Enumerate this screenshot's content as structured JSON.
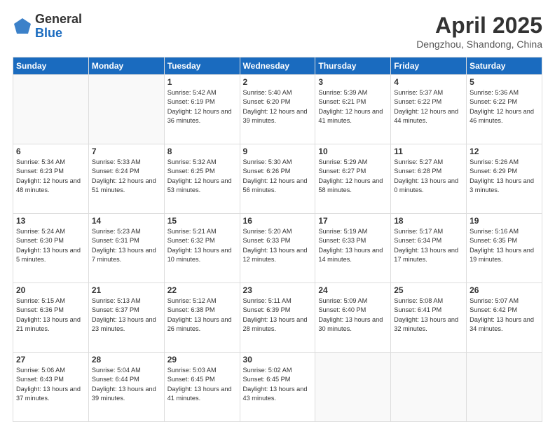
{
  "header": {
    "logo_general": "General",
    "logo_blue": "Blue",
    "month_title": "April 2025",
    "location": "Dengzhou, Shandong, China"
  },
  "weekdays": [
    "Sunday",
    "Monday",
    "Tuesday",
    "Wednesday",
    "Thursday",
    "Friday",
    "Saturday"
  ],
  "weeks": [
    [
      {
        "day": "",
        "info": ""
      },
      {
        "day": "",
        "info": ""
      },
      {
        "day": "1",
        "info": "Sunrise: 5:42 AM\nSunset: 6:19 PM\nDaylight: 12 hours and 36 minutes."
      },
      {
        "day": "2",
        "info": "Sunrise: 5:40 AM\nSunset: 6:20 PM\nDaylight: 12 hours and 39 minutes."
      },
      {
        "day": "3",
        "info": "Sunrise: 5:39 AM\nSunset: 6:21 PM\nDaylight: 12 hours and 41 minutes."
      },
      {
        "day": "4",
        "info": "Sunrise: 5:37 AM\nSunset: 6:22 PM\nDaylight: 12 hours and 44 minutes."
      },
      {
        "day": "5",
        "info": "Sunrise: 5:36 AM\nSunset: 6:22 PM\nDaylight: 12 hours and 46 minutes."
      }
    ],
    [
      {
        "day": "6",
        "info": "Sunrise: 5:34 AM\nSunset: 6:23 PM\nDaylight: 12 hours and 48 minutes."
      },
      {
        "day": "7",
        "info": "Sunrise: 5:33 AM\nSunset: 6:24 PM\nDaylight: 12 hours and 51 minutes."
      },
      {
        "day": "8",
        "info": "Sunrise: 5:32 AM\nSunset: 6:25 PM\nDaylight: 12 hours and 53 minutes."
      },
      {
        "day": "9",
        "info": "Sunrise: 5:30 AM\nSunset: 6:26 PM\nDaylight: 12 hours and 56 minutes."
      },
      {
        "day": "10",
        "info": "Sunrise: 5:29 AM\nSunset: 6:27 PM\nDaylight: 12 hours and 58 minutes."
      },
      {
        "day": "11",
        "info": "Sunrise: 5:27 AM\nSunset: 6:28 PM\nDaylight: 13 hours and 0 minutes."
      },
      {
        "day": "12",
        "info": "Sunrise: 5:26 AM\nSunset: 6:29 PM\nDaylight: 13 hours and 3 minutes."
      }
    ],
    [
      {
        "day": "13",
        "info": "Sunrise: 5:24 AM\nSunset: 6:30 PM\nDaylight: 13 hours and 5 minutes."
      },
      {
        "day": "14",
        "info": "Sunrise: 5:23 AM\nSunset: 6:31 PM\nDaylight: 13 hours and 7 minutes."
      },
      {
        "day": "15",
        "info": "Sunrise: 5:21 AM\nSunset: 6:32 PM\nDaylight: 13 hours and 10 minutes."
      },
      {
        "day": "16",
        "info": "Sunrise: 5:20 AM\nSunset: 6:33 PM\nDaylight: 13 hours and 12 minutes."
      },
      {
        "day": "17",
        "info": "Sunrise: 5:19 AM\nSunset: 6:33 PM\nDaylight: 13 hours and 14 minutes."
      },
      {
        "day": "18",
        "info": "Sunrise: 5:17 AM\nSunset: 6:34 PM\nDaylight: 13 hours and 17 minutes."
      },
      {
        "day": "19",
        "info": "Sunrise: 5:16 AM\nSunset: 6:35 PM\nDaylight: 13 hours and 19 minutes."
      }
    ],
    [
      {
        "day": "20",
        "info": "Sunrise: 5:15 AM\nSunset: 6:36 PM\nDaylight: 13 hours and 21 minutes."
      },
      {
        "day": "21",
        "info": "Sunrise: 5:13 AM\nSunset: 6:37 PM\nDaylight: 13 hours and 23 minutes."
      },
      {
        "day": "22",
        "info": "Sunrise: 5:12 AM\nSunset: 6:38 PM\nDaylight: 13 hours and 26 minutes."
      },
      {
        "day": "23",
        "info": "Sunrise: 5:11 AM\nSunset: 6:39 PM\nDaylight: 13 hours and 28 minutes."
      },
      {
        "day": "24",
        "info": "Sunrise: 5:09 AM\nSunset: 6:40 PM\nDaylight: 13 hours and 30 minutes."
      },
      {
        "day": "25",
        "info": "Sunrise: 5:08 AM\nSunset: 6:41 PM\nDaylight: 13 hours and 32 minutes."
      },
      {
        "day": "26",
        "info": "Sunrise: 5:07 AM\nSunset: 6:42 PM\nDaylight: 13 hours and 34 minutes."
      }
    ],
    [
      {
        "day": "27",
        "info": "Sunrise: 5:06 AM\nSunset: 6:43 PM\nDaylight: 13 hours and 37 minutes."
      },
      {
        "day": "28",
        "info": "Sunrise: 5:04 AM\nSunset: 6:44 PM\nDaylight: 13 hours and 39 minutes."
      },
      {
        "day": "29",
        "info": "Sunrise: 5:03 AM\nSunset: 6:45 PM\nDaylight: 13 hours and 41 minutes."
      },
      {
        "day": "30",
        "info": "Sunrise: 5:02 AM\nSunset: 6:45 PM\nDaylight: 13 hours and 43 minutes."
      },
      {
        "day": "",
        "info": ""
      },
      {
        "day": "",
        "info": ""
      },
      {
        "day": "",
        "info": ""
      }
    ]
  ]
}
